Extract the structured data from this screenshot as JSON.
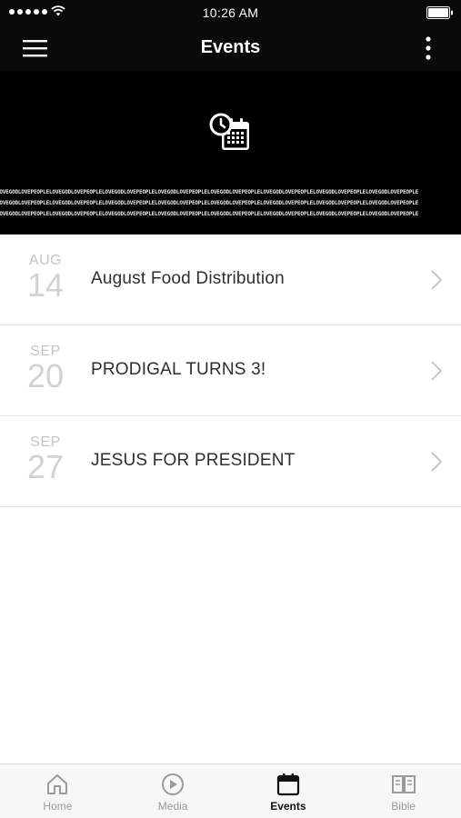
{
  "status_bar": {
    "time": "10:26 AM"
  },
  "nav": {
    "title": "Events",
    "menu_icon": "hamburger-menu-icon",
    "more_icon": "vertical-ellipsis-icon"
  },
  "banner": {
    "icon": "calendar-clock-icon",
    "pattern_text": "LOVEGODLOVEPEOPLELOVEGODLOVEPEOPLELOVEGODLOVEPEOPLELOVEGODLOVEPEOPLELOVEGODLOVEPEOPLELOVEGODLOVEPEOPLELOVEGODLOVEPEOPLELOVEGODLOVEPEOPLE"
  },
  "events": [
    {
      "month": "AUG",
      "day": "14",
      "name": "August Food Distribution"
    },
    {
      "month": "SEP",
      "day": "20",
      "name": "PRODIGAL TURNS 3!"
    },
    {
      "month": "SEP",
      "day": "27",
      "name": "JESUS FOR PRESIDENT"
    }
  ],
  "tabs": [
    {
      "label": "Home",
      "icon": "home-icon",
      "active": false
    },
    {
      "label": "Media",
      "icon": "play-circle-icon",
      "active": false
    },
    {
      "label": "Events",
      "icon": "calendar-icon",
      "active": true
    },
    {
      "label": "Bible",
      "icon": "open-book-icon",
      "active": false
    }
  ],
  "colors": {
    "header_bg": "#0a0a0a",
    "banner_bg": "#000000",
    "date_text": "#c4c4c4",
    "title_text": "#2e2e2e",
    "tab_active": "#111111",
    "tab_inactive": "#9a9a9a"
  }
}
